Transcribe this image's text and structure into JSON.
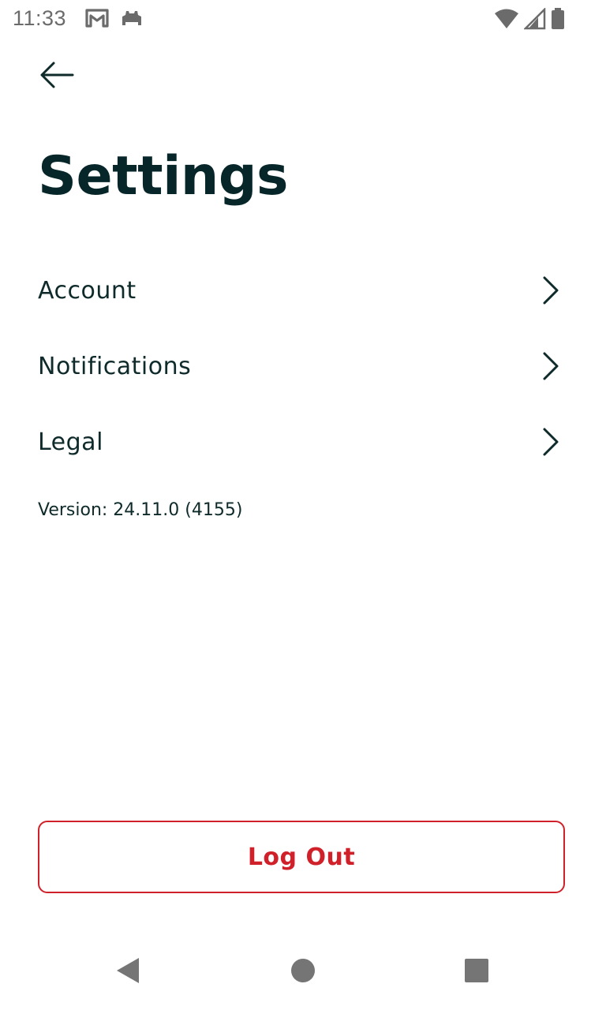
{
  "status_bar": {
    "time": "11:33",
    "notification_icons": [
      "gmail-icon",
      "android-debug-icon"
    ],
    "system_icons": [
      "wifi-icon",
      "cellular-signal-icon",
      "battery-icon"
    ]
  },
  "header": {
    "back_icon": "arrow-left-icon"
  },
  "page": {
    "title": "Settings"
  },
  "menu": {
    "items": [
      {
        "label": "Account",
        "icon": "chevron-right-icon"
      },
      {
        "label": "Notifications",
        "icon": "chevron-right-icon"
      },
      {
        "label": "Legal",
        "icon": "chevron-right-icon"
      }
    ]
  },
  "version": {
    "text": "Version: 24.11.0 (4155)"
  },
  "logout": {
    "label": "Log Out",
    "color": "#d0202a"
  },
  "nav_bar": {
    "buttons": [
      "back-triangle-icon",
      "home-circle-icon",
      "recents-square-icon"
    ]
  },
  "colors": {
    "title": "#06262a",
    "text": "#0f2a2a",
    "accent_red": "#d0202a",
    "status_gray": "#6b6b6b"
  }
}
